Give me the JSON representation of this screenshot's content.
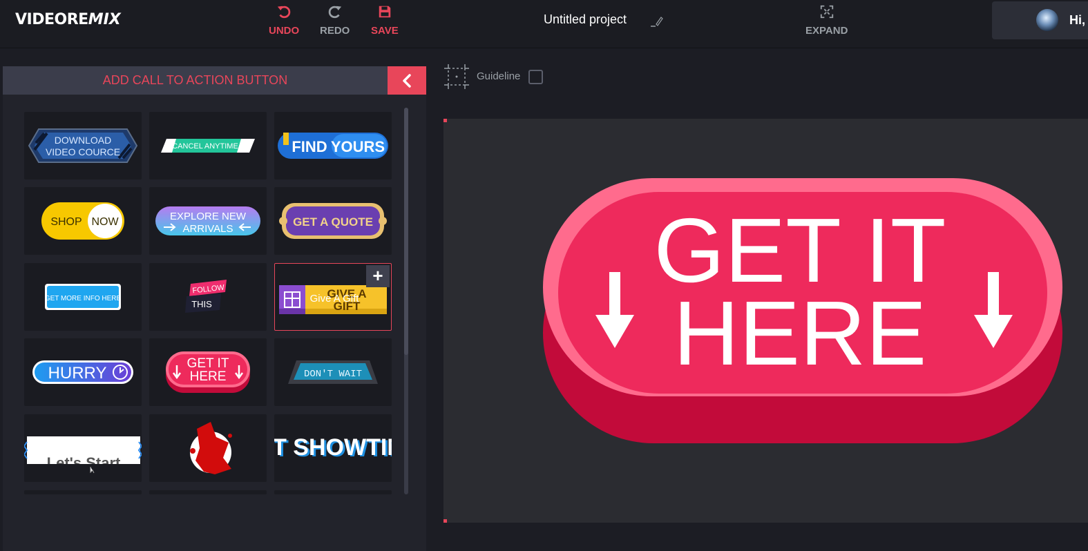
{
  "app": {
    "logo_main": "VIDEORE",
    "logo_tail": "MIX"
  },
  "toolbar": {
    "undo_label": "UNDO",
    "redo_label": "REDO",
    "save_label": "SAVE",
    "expand_label": "EXPAND"
  },
  "project": {
    "title": "Untitled project"
  },
  "user": {
    "greeting": "Hi,"
  },
  "panel": {
    "title": "ADD CALL TO ACTION BUTTON"
  },
  "guideline": {
    "label": "Guideline"
  },
  "tiles": [
    {
      "id": "download-video",
      "line1": "DOWNLOAD",
      "line2": "VIDEO COURCE"
    },
    {
      "id": "cancel-anytime",
      "line1": "CANCEL ANYTIME"
    },
    {
      "id": "find-yours",
      "line1": "FIND",
      "line2": "YOURS"
    },
    {
      "id": "shop-now",
      "line1": "SHOP",
      "line2": "NOW"
    },
    {
      "id": "explore-new-arrivals",
      "line1": "EXPLORE NEW",
      "line2": "ARRIVALS"
    },
    {
      "id": "get-a-quote",
      "line1": "GET A QUOTE"
    },
    {
      "id": "get-more-info",
      "line1": "GET MORE INFO HERE"
    },
    {
      "id": "follow-this",
      "line1": "FOLLOW",
      "line2": "THIS"
    },
    {
      "id": "give-a-gift",
      "line1": "GIVE A",
      "line2": "GIFT",
      "overlay": "Give A Gift"
    },
    {
      "id": "hurry",
      "line1": "HURRY"
    },
    {
      "id": "get-it-here",
      "line1": "GET IT",
      "line2": "HERE"
    },
    {
      "id": "dont-wait",
      "line1": "DON'T WAIT"
    },
    {
      "id": "lets-start",
      "line1": "Let's Start"
    },
    {
      "id": "red-splash",
      "line1": ""
    },
    {
      "id": "showtime",
      "line1": "ET SHOWTIM"
    }
  ],
  "preview": {
    "line1": "GET IT",
    "line2": "HERE"
  },
  "colors": {
    "accent": "#e8465a",
    "pink": "#ee2a5c",
    "pink_dark": "#c20b3a",
    "pink_light": "#ff6b8d"
  }
}
